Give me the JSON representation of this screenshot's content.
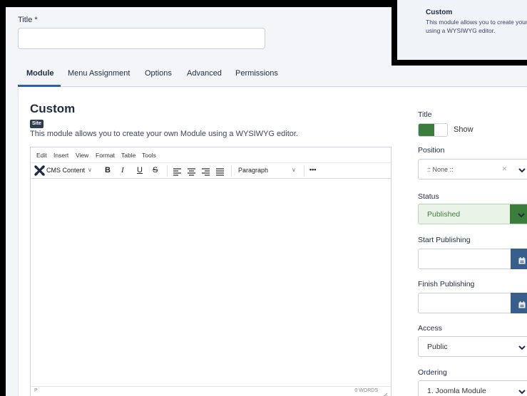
{
  "form": {
    "title_label": "Title *",
    "title_value": ""
  },
  "tabs": [
    {
      "label": "Module",
      "active": true
    },
    {
      "label": "Menu Assignment"
    },
    {
      "label": "Options"
    },
    {
      "label": "Advanced"
    },
    {
      "label": "Permissions"
    }
  ],
  "module": {
    "heading": "Custom",
    "badge": "Site",
    "description": "This module allows you to create your own Module using a WYSIWYG editor."
  },
  "editor": {
    "menus": [
      "Edit",
      "Insert",
      "View",
      "Format",
      "Table",
      "Tools"
    ],
    "cms_content": "CMS Content",
    "bold": "B",
    "italic": "I",
    "underline": "U",
    "strike": "S",
    "paragraph": "Paragraph",
    "more": "•••",
    "status_path": "P",
    "word_count": "0 WORDS"
  },
  "sidebar": {
    "title_label": "Title",
    "show_label": "Show",
    "show_on": true,
    "position_label": "Position",
    "position_value": ":: None ::",
    "status_label": "Status",
    "status_value": "Published",
    "start_label": "Start Publishing",
    "start_value": "",
    "finish_label": "Finish Publishing",
    "finish_value": "",
    "access_label": "Access",
    "access_value": "Public",
    "ordering_label": "Ordering",
    "ordering_value": "1. Joomla Module"
  },
  "popover": {
    "title": "Custom",
    "text": "This module allows you to create your own Module using a WYSIWYG editor."
  },
  "colors": {
    "accent": "#2f5fa6",
    "success": "#3b7d3a",
    "calendar_button": "#385e8c"
  }
}
